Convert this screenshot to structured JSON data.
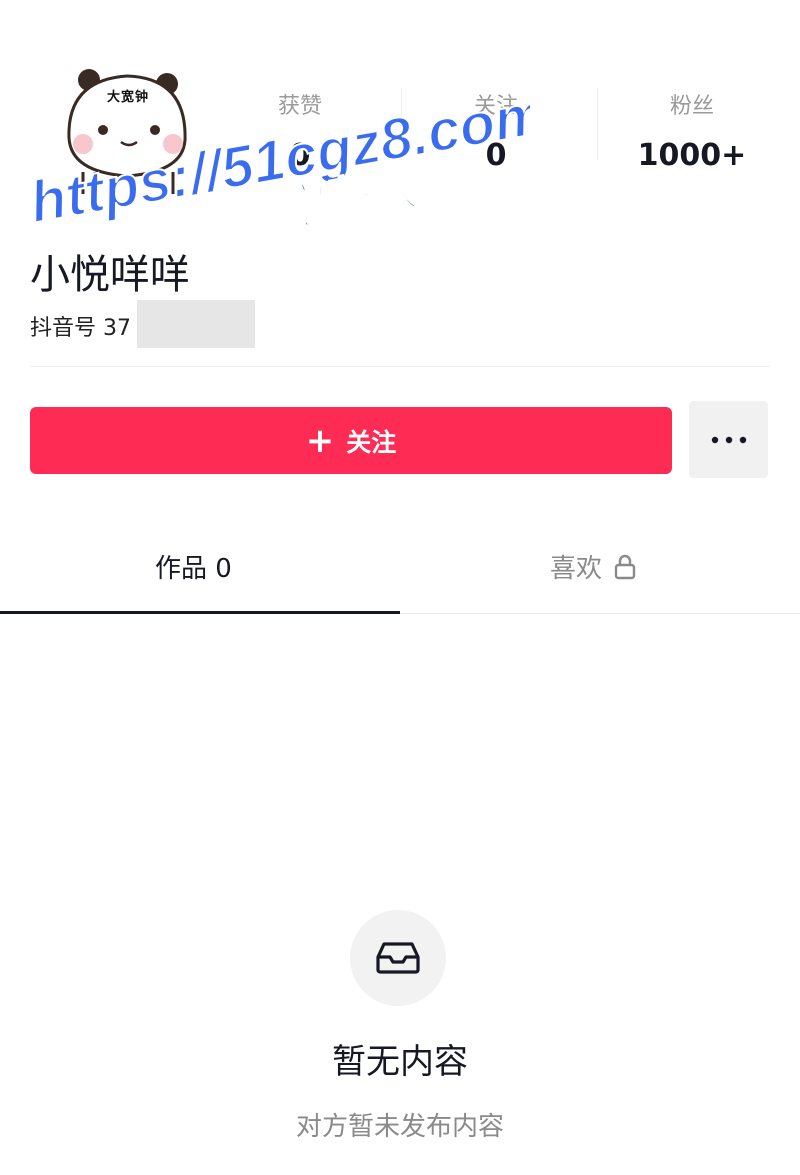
{
  "profile": {
    "avatar_text": "大宽钟",
    "nickname": "小悦咩咩",
    "douyin_id": "抖音号 37              37"
  },
  "stats": [
    {
      "label": "获赞",
      "value": "0"
    },
    {
      "label": "关注",
      "value": "0"
    },
    {
      "label": "粉丝",
      "value": "1000+"
    }
  ],
  "actions": {
    "follow_plus": "+",
    "follow_label": "关注",
    "more_icon": "more-dots-icon"
  },
  "tabs": {
    "works": "作品 0",
    "likes": "喜欢"
  },
  "empty_state": {
    "icon": "inbox-icon",
    "title": "暂无内容",
    "subtitle": "对方暂未发布内容"
  },
  "watermark": {
    "line1": "https://51cgz8.com",
    "line2": "看完整版",
    "color": "#3a6cf0"
  },
  "colors": {
    "accent": "#fe2c55",
    "text_primary": "#161823",
    "text_secondary": "#8a8a8a"
  }
}
